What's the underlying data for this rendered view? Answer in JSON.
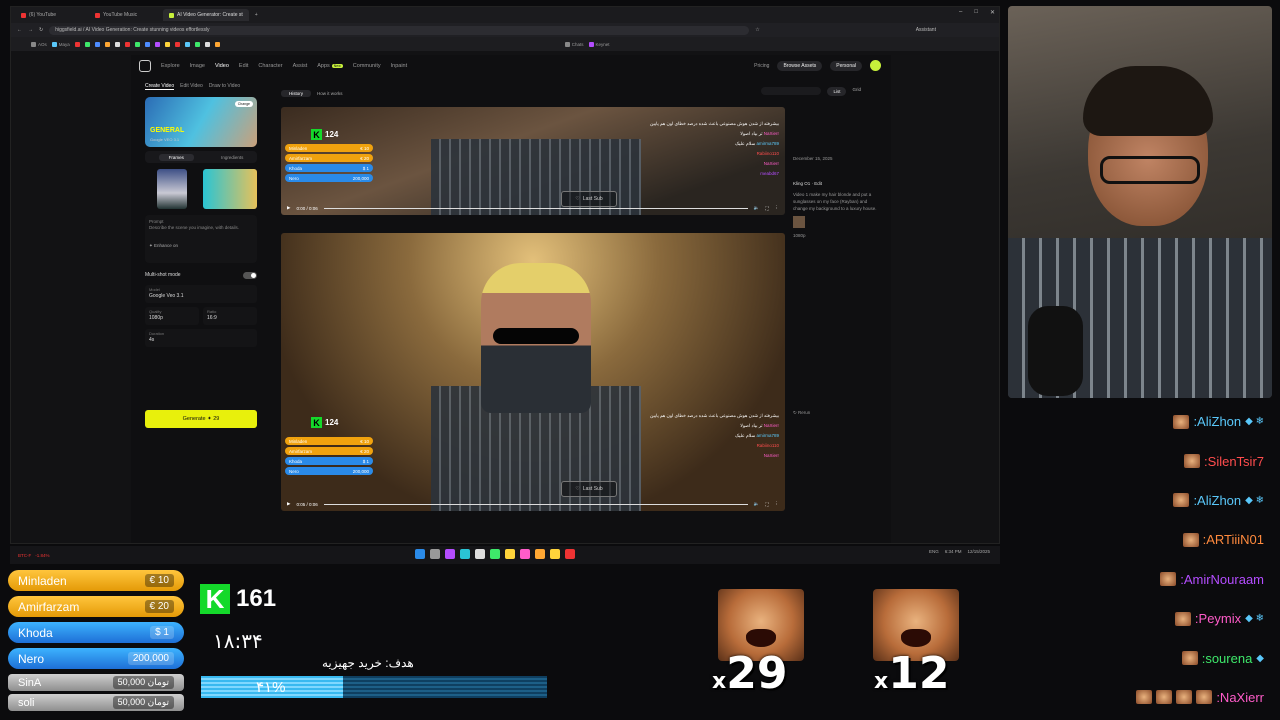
{
  "browser": {
    "tabs": [
      {
        "label": "(6) YouTube",
        "active": false
      },
      {
        "label": "YouTube Music",
        "active": false
      },
      {
        "label": "AI Video Generator: Create st",
        "active": true
      }
    ],
    "new_tab": "+",
    "url": "higgsfield.ai / AI Video Generation: Create stunning videos effortlessly",
    "bookmarks": [
      "AOs",
      "Maya",
      "Chats",
      "Keynet"
    ],
    "assistant": "Assistant"
  },
  "app": {
    "nav": [
      "Explore",
      "Image",
      "Video",
      "Edit",
      "Character",
      "Assist",
      "Apps",
      "Community",
      "Inpaint"
    ],
    "new_badge": "New",
    "pricing": "Pricing",
    "browse": "Browse Assets",
    "personal": "Personal",
    "left_tabs": [
      "Create Video",
      "Edit Video",
      "Draw to Video"
    ],
    "gen_title": "GENERAL",
    "gen_sub": "Google VEO 3.1",
    "change": "Change",
    "frames": "Frames",
    "ingredients": "Ingredients",
    "prompt_label": "Prompt",
    "prompt_placeholder": "Describe the scene you imagine, with details.",
    "enhance": "Enhance on",
    "multishot": "Multi-shot mode",
    "model_label": "Model",
    "model": "Google Veo 3.1",
    "quality_label": "Quality",
    "quality": "1080p",
    "ratio_label": "Ratio",
    "ratio": "16:9",
    "duration_label": "Duration",
    "duration": "4s",
    "generate": "Generate ✦ 29",
    "history": "History",
    "how": "How it works",
    "list": "List",
    "grid": "Grid",
    "date": "December 15, 2025",
    "side_tags": [
      "Kling O1",
      "Edit"
    ],
    "side_prompt": "Video 1 make my hair blonde and put a sunglasses on my face (Rayban) and change my background to a luxury house.",
    "side_res": "1080p",
    "rerun": "Rerun"
  },
  "video_overlay": {
    "k_count": "124",
    "donors": [
      "Minladen",
      "Amirfarzam",
      "Khoda",
      "Nero"
    ],
    "amounts": [
      "€ 10",
      "€ 20",
      "$ 1",
      "200,000"
    ],
    "chat_line1": "بیشرفته از شدن هوش مصنوعی باعث شده درصد خطای اون هم پایین تر بیاد اصولا",
    "chat_names": [
      "NaXierr",
      "amirma789",
      "Rabiino110",
      "NaXierr",
      "meabd67"
    ],
    "chat_line2": "سلام علیک",
    "last_sub": "Last Sub",
    "time1": "0:00 / 0:06",
    "time2": "0:05 / 0:06",
    "goal_mini": "هدف: خرید جهیزیه"
  },
  "taskbar": {
    "ticker": "BTC-F",
    "ticker_val": "-1.84%",
    "lang": "ENG",
    "time": "6:34 PM",
    "date": "12/15/2025"
  },
  "overlay": {
    "donors": [
      {
        "name": "Minladen",
        "amount": "€ 10",
        "style": "y"
      },
      {
        "name": "Amirfarzam",
        "amount": "€ 20",
        "style": "y"
      },
      {
        "name": "Khoda",
        "amount": "$ 1",
        "style": "b"
      },
      {
        "name": "Nero",
        "amount": "200,000",
        "style": "b"
      },
      {
        "name": "SinA",
        "amount": "50,000 تومان",
        "style": "g"
      },
      {
        "name": "soli",
        "amount": "50,000 تومان",
        "style": "g"
      }
    ],
    "k_count": "161",
    "clock": "۱۸:۳۴",
    "goal": "هدف: خرید جهیزیه",
    "goal_pct": "۴۱%",
    "goal_fraction": 0.41,
    "combo1": "29",
    "combo2": "12",
    "combo_x": "x"
  },
  "chat": [
    {
      "name": ":AliZhon",
      "color": "#5ac8fa",
      "badge": "◆ ❄",
      "emotes": 1
    },
    {
      "name": ":SilenTsir7",
      "color": "#ff4d4d",
      "badge": "",
      "emotes": 1
    },
    {
      "name": ":AliZhon",
      "color": "#5ac8fa",
      "badge": "◆ ❄",
      "emotes": 1
    },
    {
      "name": ":ARTiiiN01",
      "color": "#ff8a3d",
      "badge": "",
      "emotes": 1
    },
    {
      "name": ":AmirNouraam",
      "color": "#b44dff",
      "badge": "",
      "emotes": 1
    },
    {
      "name": ":Peymix",
      "color": "#ff5cc9",
      "badge": "◆ ❄",
      "emotes": 1
    },
    {
      "name": ":sourena",
      "color": "#3ee86a",
      "badge": "◆",
      "emotes": 1
    },
    {
      "name": ":NaXierr",
      "color": "#ff5cc9",
      "badge": "",
      "emotes": 4
    }
  ]
}
